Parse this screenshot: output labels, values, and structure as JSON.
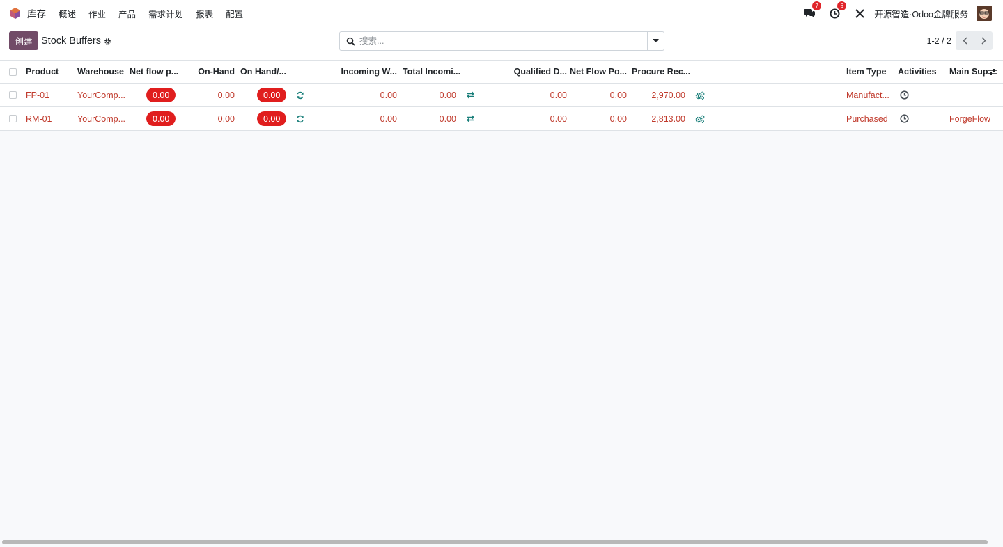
{
  "navbar": {
    "app_name": "库存",
    "menu": [
      "概述",
      "作业",
      "产品",
      "需求计划",
      "报表",
      "配置"
    ],
    "messages_count": "7",
    "activities_count": "6",
    "company": "开源智造·Odoo金牌服务"
  },
  "control": {
    "create_label": "创建",
    "breadcrumb": "Stock Buffers",
    "search_placeholder": "搜索...",
    "pager": "1-2 / 2"
  },
  "table": {
    "headers": {
      "product": "Product",
      "warehouse": "Warehouse",
      "net_flow": "Net flow p...",
      "on_hand": "On-Hand",
      "on_hand_pct": "On Hand/...",
      "incoming_w": "Incoming W...",
      "total_incoming": "Total Incomi...",
      "qualified_d": "Qualified D...",
      "net_flow_po": "Net Flow Po...",
      "procure_rec": "Procure Rec...",
      "item_type": "Item Type",
      "activities": "Activities",
      "main_sup": "Main Sup"
    },
    "rows": [
      {
        "product": "FP-01",
        "warehouse": "YourComp...",
        "net_flow": "0.00",
        "on_hand": "0.00",
        "on_hand_pct": "0.00",
        "incoming_w": "0.00",
        "total_incoming": "0.00",
        "qualified_d": "0.00",
        "net_flow_po": "0.00",
        "procure_rec": "2,970.00",
        "item_type": "Manufact...",
        "main_sup": ""
      },
      {
        "product": "RM-01",
        "warehouse": "YourComp...",
        "net_flow": "0.00",
        "on_hand": "0.00",
        "on_hand_pct": "0.00",
        "incoming_w": "0.00",
        "total_incoming": "0.00",
        "qualified_d": "0.00",
        "net_flow_po": "0.00",
        "procure_rec": "2,813.00",
        "item_type": "Purchased",
        "main_sup": "ForgeFlow"
      }
    ]
  },
  "colors": {
    "brand": "#714b67",
    "alert_pill": "#e01e1e",
    "link": "#c0392b",
    "action_icon": "#1a7f7a"
  }
}
